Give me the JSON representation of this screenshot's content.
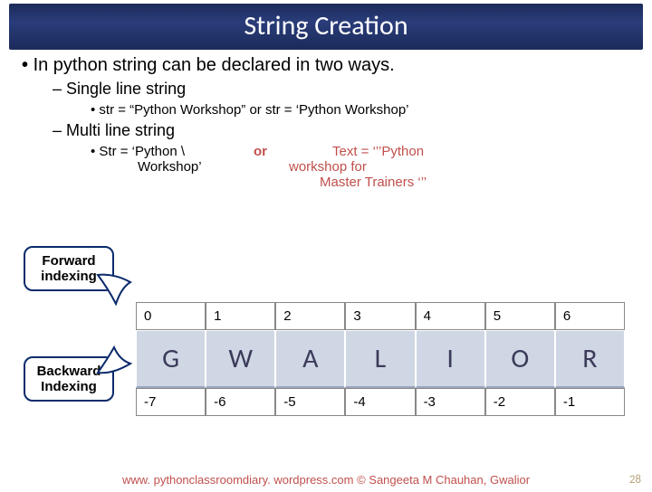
{
  "title": "String Creation",
  "bullets": {
    "main": "In python string can be declared in two ways.",
    "single_heading": "Single line string",
    "single_example": "str = “Python Workshop” or str = ‘Python Workshop’",
    "multi_heading": "Multi line string",
    "multi_left_bullet": "• Str = ‘Python \\",
    "multi_left_line2": "Workshop’",
    "multi_or": "or",
    "multi_right_l1": "Text = ‘’’Python",
    "multi_right_l2": "workshop for",
    "multi_right_l3": "Master Trainers ‘’’"
  },
  "callouts": {
    "forward": "Forward indexing",
    "backward": "Backward Indexing"
  },
  "table": {
    "forward_idx": [
      "0",
      "1",
      "2",
      "3",
      "4",
      "5",
      "6"
    ],
    "letters": [
      "G",
      "W",
      "A",
      "L",
      "I",
      "O",
      "R"
    ],
    "backward_idx": [
      "-7",
      "-6",
      "-5",
      "-4",
      "-3",
      "-2",
      "-1"
    ]
  },
  "footer": "www. pythonclassroomdiary. wordpress.com ©  Sangeeta M Chauhan, Gwalior",
  "page": "28"
}
